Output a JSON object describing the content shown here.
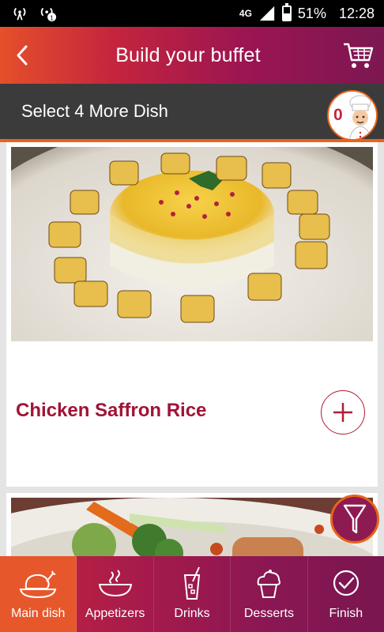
{
  "status_bar": {
    "network": "4G",
    "battery": "51%",
    "battery_level": 0.51,
    "time": "12:28"
  },
  "header": {
    "title": "Build your buffet",
    "back_icon": "chevron-left-icon",
    "cart_icon": "cart-icon"
  },
  "subheader": {
    "text": "Select 4 More Dish",
    "count": "0"
  },
  "dishes": [
    {
      "name": "Chicken Saffron Rice",
      "add_icon": "plus-icon"
    },
    {
      "name": ""
    }
  ],
  "filter_icon": "filter-icon",
  "tabs": [
    {
      "label": "Main dish",
      "icon": "chicken-icon",
      "active": true
    },
    {
      "label": "Appetizers",
      "icon": "bowl-icon",
      "active": false
    },
    {
      "label": "Drinks",
      "icon": "drink-icon",
      "active": false
    },
    {
      "label": "Desserts",
      "icon": "cupcake-icon",
      "active": false
    },
    {
      "label": "Finish",
      "icon": "check-circle-icon",
      "active": false
    }
  ],
  "colors": {
    "accent_orange": "#e8641a",
    "brand_red": "#c4243e",
    "brand_purple": "#7c1752",
    "dish_name": "#a11335"
  }
}
